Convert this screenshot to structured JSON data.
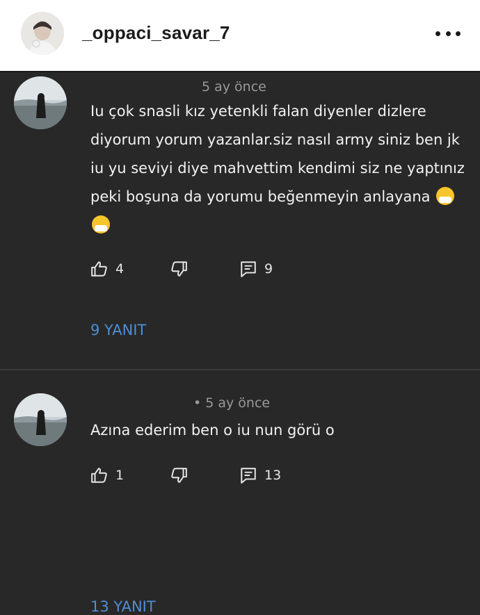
{
  "header": {
    "username": "_oppaci_savar_7",
    "menu_icon": "more-horizontal-icon"
  },
  "comments": [
    {
      "time": "5 ay önce",
      "text": "Iu çok snasli kız yetenkli falan diyenler dizlere diyorum yorum yazanlar.siz nasıl army siniz ben jk iu yu seviyi diye mahvettim kendimi siz ne yaptınız peki boşuna da yorumu beğenmeyin anlayana",
      "emojis": [
        "sneezing-face-emoji",
        "sneezing-face-emoji"
      ],
      "likes": "4",
      "reply_count": "9",
      "replies_label": "9 YANIT"
    },
    {
      "time": "• 5 ay önce",
      "text": "Azına ederim ben o iu nun görü o",
      "likes": "1",
      "reply_count": "13",
      "replies_label": "13 YANIT"
    }
  ],
  "icons": {
    "like": "thumbs-up-icon",
    "dislike": "thumbs-down-icon",
    "reply": "comment-icon"
  },
  "colors": {
    "background": "#282828",
    "header_bg": "#ffffff",
    "text": "#f2f2f2",
    "muted": "#9a9a9a",
    "link": "#4d8fd6"
  }
}
